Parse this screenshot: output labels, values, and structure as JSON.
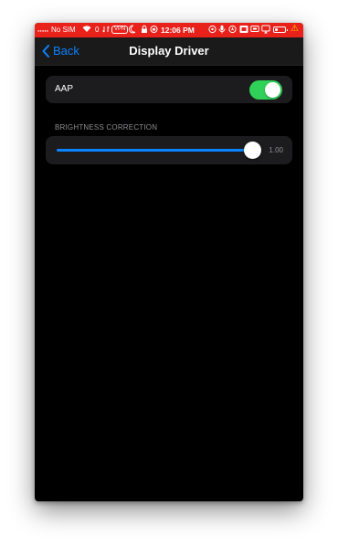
{
  "status_bar": {
    "carrier": "No SIM",
    "count": "0",
    "vpn": "VPN",
    "time": "12:06 PM",
    "background_color": "#e8211b"
  },
  "nav": {
    "back_label": "Back",
    "title": "Display Driver",
    "accent_color": "#0a84ff"
  },
  "settings": {
    "aap": {
      "label": "AAP",
      "enabled": true,
      "toggle_color": "#30d158"
    },
    "brightness_correction": {
      "header": "BRIGHTNESS CORRECTION",
      "value": 1.0,
      "value_label": "1.00",
      "fill_fraction": 1.0
    }
  }
}
